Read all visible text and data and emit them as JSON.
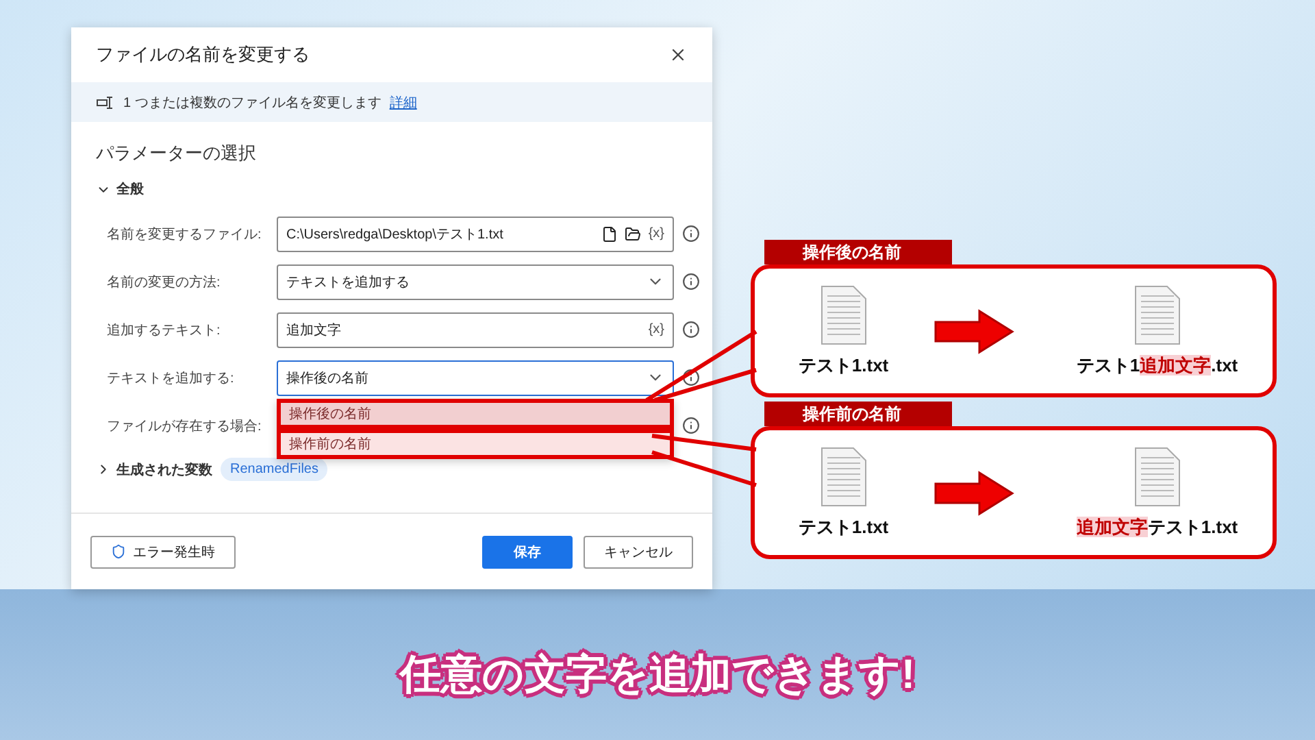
{
  "dialog": {
    "title": "ファイルの名前を変更する",
    "info": {
      "text": "1 つまたは複数のファイル名を変更します",
      "link": "詳細"
    },
    "section_title": "パラメーターの選択",
    "group": {
      "label": "全般",
      "expanded": true
    },
    "fields": [
      {
        "kind": "file",
        "label": "名前を変更するファイル:",
        "value": "C:\\Users\\redga\\Desktop\\テスト1.txt",
        "token": "{x}"
      },
      {
        "kind": "dropdown",
        "label": "名前の変更の方法:",
        "value": "テキストを追加する",
        "expanded": false
      },
      {
        "kind": "text",
        "label": "追加するテキスト:",
        "value": "追加文字",
        "token": "{x}"
      },
      {
        "kind": "dropdown",
        "label": "テキストを追加する:",
        "value": "操作後の名前",
        "expanded": true,
        "options": [
          {
            "label": "操作後の名前",
            "selected": true
          },
          {
            "label": "操作前の名前",
            "selected": false
          }
        ]
      },
      {
        "kind": "covered",
        "label": "ファイルが存在する場合:"
      }
    ],
    "variables": {
      "label": "生成された変数",
      "expanded": false,
      "chip": "RenamedFiles"
    },
    "footer": {
      "error_button": "エラー発生時",
      "save": "保存",
      "cancel": "キャンセル"
    }
  },
  "callouts": [
    {
      "title": "操作後の名前",
      "before": "テスト1.txt",
      "after": [
        {
          "text": "テスト1",
          "highlight": false
        },
        {
          "text": "追加文字",
          "highlight": true
        },
        {
          "text": ".txt",
          "highlight": false
        }
      ]
    },
    {
      "title": "操作前の名前",
      "before": "テスト1.txt",
      "after": [
        {
          "text": "追加文字",
          "highlight": true
        },
        {
          "text": "テスト1.txt",
          "highlight": false
        }
      ]
    }
  ],
  "caption": "任意の文字を追加できます!"
}
